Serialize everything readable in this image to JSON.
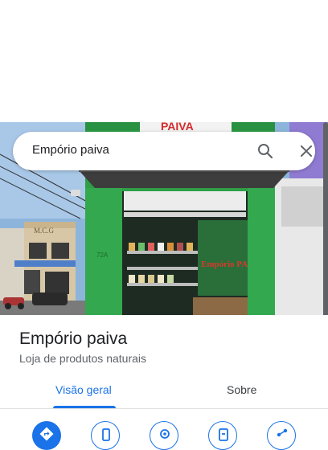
{
  "search": {
    "query": "Empório paiva",
    "search_icon": "search-icon",
    "close_icon": "close-icon"
  },
  "photo": {
    "sign_text": "PAIVA",
    "building_text": "M.C.G",
    "number_text": "72A",
    "window_logo": "Empório PAIVA"
  },
  "place": {
    "name": "Empório paiva",
    "category": "Loja de produtos naturais"
  },
  "tabs": [
    {
      "label": "Visão geral",
      "active": true
    },
    {
      "label": "Sobre",
      "active": false
    }
  ],
  "actions": [
    {
      "icon": "directions-icon"
    },
    {
      "icon": "phone-icon"
    },
    {
      "icon": "location-icon"
    },
    {
      "icon": "save-icon"
    },
    {
      "icon": "share-icon"
    }
  ],
  "colors": {
    "accent": "#1a73e8",
    "storefront_green": "#2e9e47"
  }
}
